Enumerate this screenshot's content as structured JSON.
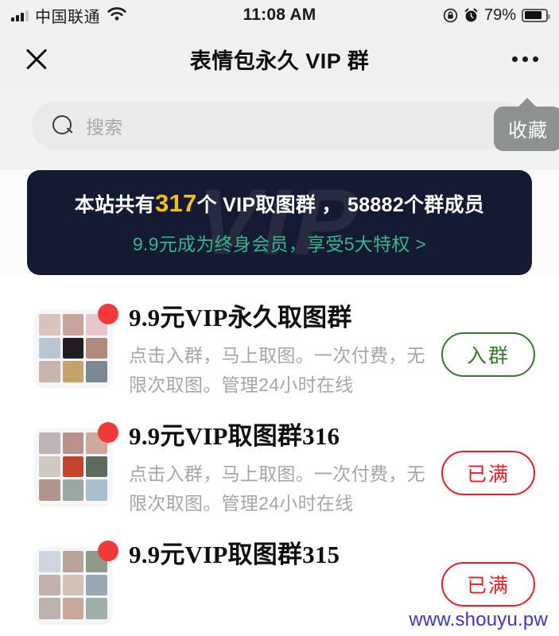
{
  "status_bar": {
    "carrier": "中国联通",
    "time": "11:08 AM",
    "battery_percent": "79%",
    "icons": [
      "signal-bars-icon",
      "wifi-icon",
      "rotation-lock-icon",
      "alarm-icon",
      "battery-icon"
    ]
  },
  "nav": {
    "close_label": "✕",
    "title": "表情包永久 VIP 群",
    "more_label": "•••"
  },
  "search": {
    "placeholder": "搜索",
    "value": "",
    "favorite_badge": "收藏"
  },
  "banner": {
    "watermark_text": "VIP",
    "line1_prefix": "本站共有",
    "line1_count": "317",
    "line1_suffix": "个 VIP取图群 ， 58882个群成员",
    "line2": "9.9元成为终身会员，享受5大特权 >",
    "gold_color": "#f3c019",
    "green_color": "#37b58d",
    "bg_color": "#151a33"
  },
  "groups": [
    {
      "title": "9.9元VIP永久取图群",
      "desc": "点击入群，马上取图。一次付费，无限次取图。管理24小时在线",
      "button": "入群",
      "state": "join",
      "badge": "new-dot"
    },
    {
      "title": "9.9元VIP取图群316",
      "desc": "点击入群，马上取图。一次付费，无限次取图。管理24小时在线",
      "button": "已满",
      "state": "full",
      "badge": "new-dot"
    },
    {
      "title": "9.9元VIP取图群315",
      "desc": "",
      "button": "已满",
      "state": "full",
      "badge": "new-dot"
    }
  ],
  "watermark": "www.shouyu.pw",
  "colors": {
    "join_button": "#337b2b",
    "full_button": "#ec1b25",
    "badge_dot": "#f23a3a",
    "watermark": "#3b35c8"
  }
}
